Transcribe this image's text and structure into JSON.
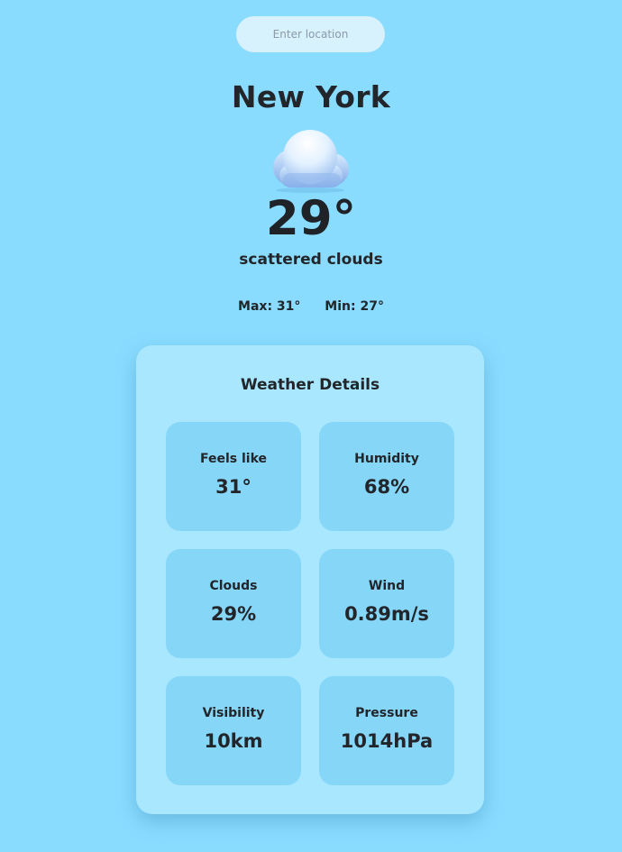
{
  "search": {
    "placeholder": "Enter location",
    "value": ""
  },
  "weather": {
    "city": "New York",
    "icon": "cloud-icon",
    "temperature": "29°",
    "description": "scattered clouds",
    "max_label": "Max: 31°",
    "min_label": "Min: 27°"
  },
  "details": {
    "title": "Weather Details",
    "items": [
      {
        "label": "Feels like",
        "value": "31°"
      },
      {
        "label": "Humidity",
        "value": "68%"
      },
      {
        "label": "Clouds",
        "value": "29%"
      },
      {
        "label": "Wind",
        "value": "0.89m/s"
      },
      {
        "label": "Visibility",
        "value": "10km"
      },
      {
        "label": "Pressure",
        "value": "1014hPa"
      }
    ]
  },
  "colors": {
    "background": "#8adcff",
    "card": "#a9e7ff",
    "tile": "#86d6f8",
    "text": "#22262a"
  }
}
